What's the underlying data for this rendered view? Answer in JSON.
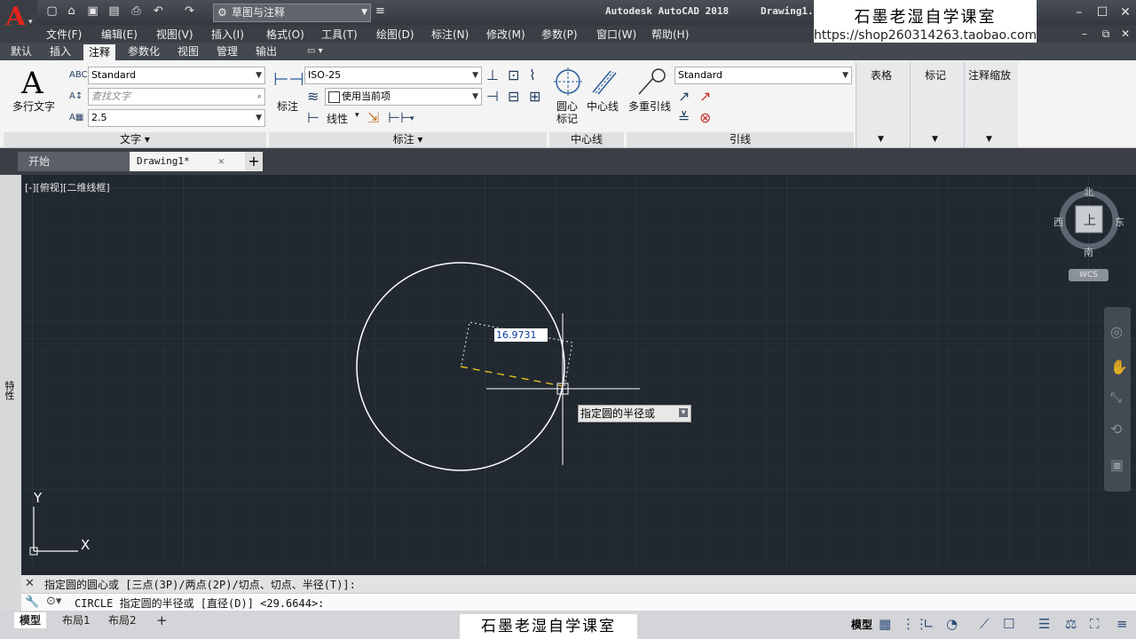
{
  "app": {
    "title": "Autodesk AutoCAD 2018",
    "doc_title": "Drawing1.",
    "workspace": "草图与注释"
  },
  "watermark": {
    "top_line1": "石墨老湿自学课室",
    "top_line2": "https://shop260314263.taobao.com",
    "bottom": "石墨老湿自学课室"
  },
  "menu": [
    "文件(F)",
    "编辑(E)",
    "视图(V)",
    "插入(I)",
    "格式(O)",
    "工具(T)",
    "绘图(D)",
    "标注(N)",
    "修改(M)",
    "参数(P)",
    "窗口(W)",
    "帮助(H)"
  ],
  "ribbon_tabs": [
    "默认",
    "插入",
    "注释",
    "参数化",
    "视图",
    "管理",
    "输出"
  ],
  "ribbon": {
    "text": {
      "big_button": "多行文字",
      "style": "Standard",
      "find_placeholder": "查找文字",
      "height": "2.5",
      "panel_title": "文字 ▾"
    },
    "dimension": {
      "big_button": "标注",
      "style": "ISO-25",
      "layer": "使用当前项",
      "linear": "线性",
      "panel_title": "标注 ▾"
    },
    "centerline": {
      "mark": "圆心",
      "mark2": "标记",
      "line": "中心线",
      "panel_title": "中心线"
    },
    "leader": {
      "big_button": "多重引线",
      "style": "Standard",
      "panel_title": "引线"
    },
    "collapsed": [
      "表格",
      "标记",
      "注释缩放"
    ]
  },
  "doc_tabs": [
    "开始",
    "Drawing1*"
  ],
  "viewport_label": "[-][俯视][二维线框]",
  "left_palette_label": "特性",
  "viewcube": {
    "north": "北",
    "south": "南",
    "east": "东",
    "west": "西",
    "top": "上",
    "wcs": "WCS"
  },
  "ucs": {
    "x": "X",
    "y": "Y"
  },
  "dynamic_input": {
    "value": "16.9731",
    "prompt": "指定圆的半径或"
  },
  "command": {
    "history": "指定圆的圆心或 [三点(3P)/两点(2P)/切点、切点、半径(T)]:",
    "current": "CIRCLE 指定圆的半径或 [直径(D)] <29.6644>:"
  },
  "layout_tabs": [
    "模型",
    "布局1",
    "布局2"
  ],
  "status": {
    "model": "模型"
  }
}
